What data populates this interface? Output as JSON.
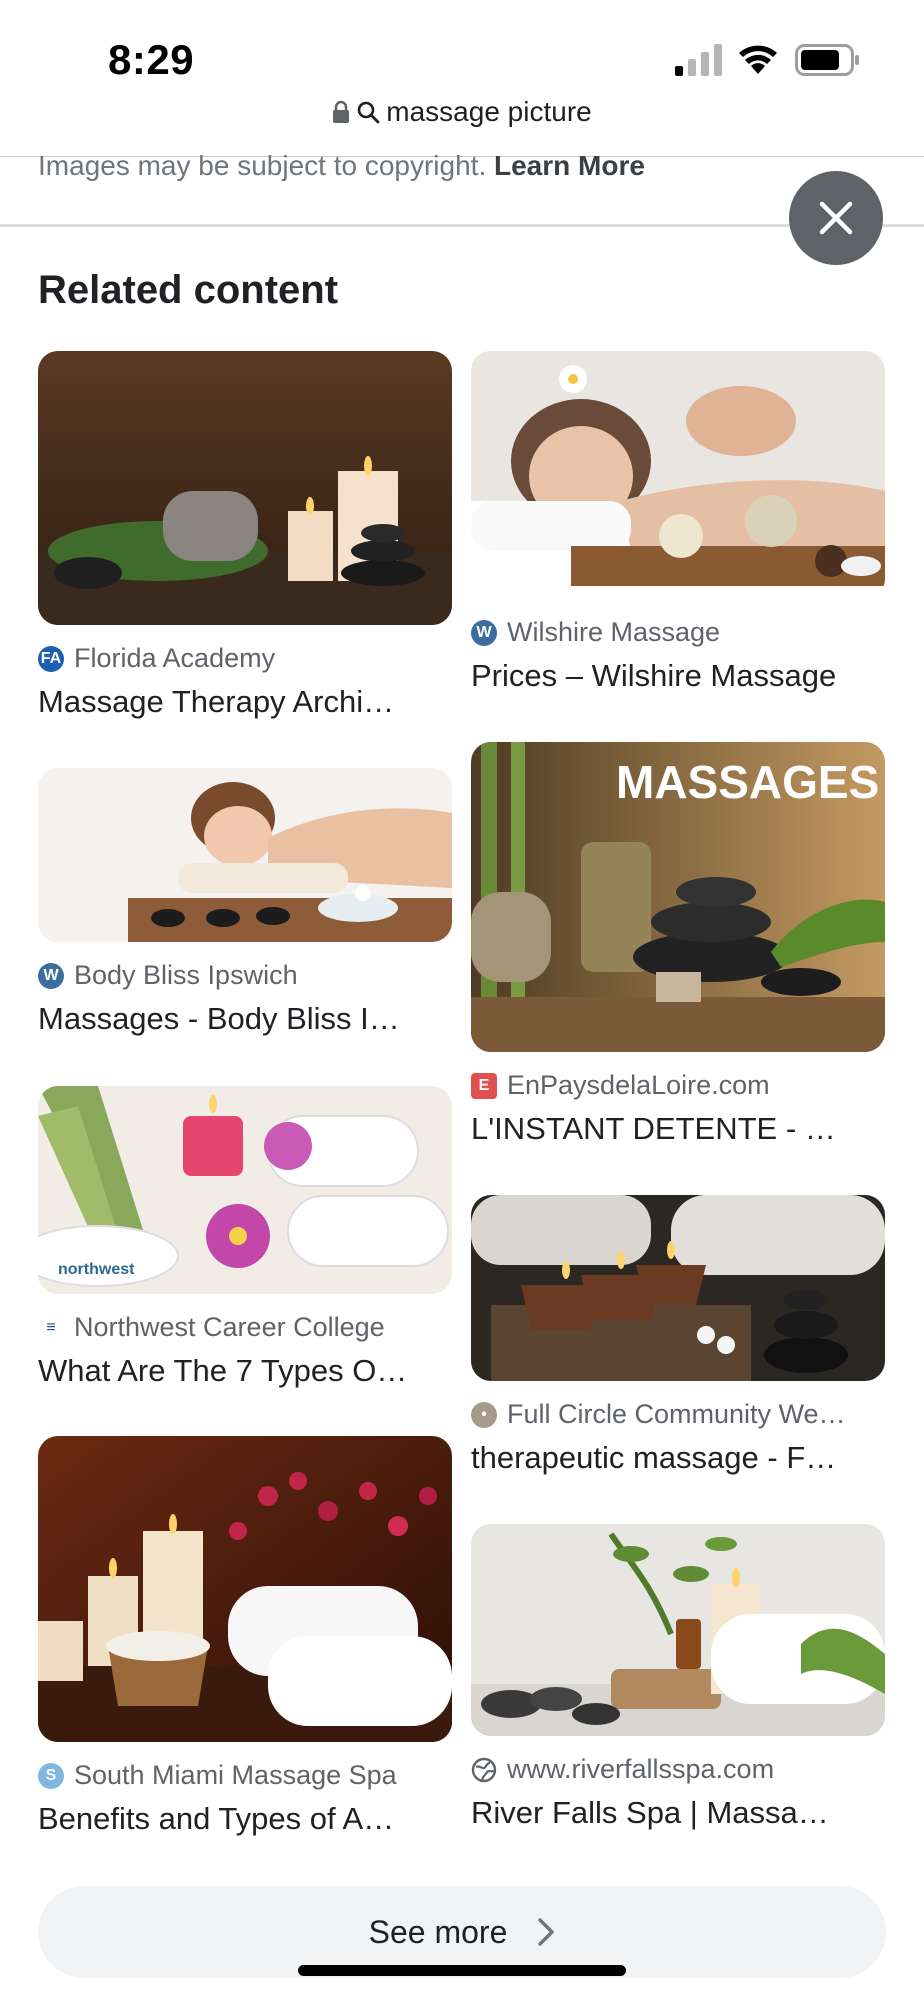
{
  "status": {
    "time": "8:29"
  },
  "browser": {
    "url_text": "massage picture"
  },
  "banner": {
    "text": "Images may be subject to copyright. ",
    "link": "Learn More"
  },
  "section": {
    "title": "Related content"
  },
  "results": [
    {
      "source": "Florida Academy",
      "title": "Massage Therapy Archi…"
    },
    {
      "source": "Wilshire Massage",
      "title": "Prices – Wilshire Massage"
    },
    {
      "source": "Body Bliss Ipswich",
      "title": "Massages - Body Bliss I…"
    },
    {
      "source": "EnPaysdelaLoire.com",
      "title": "L'INSTANT DETENTE - …",
      "image_text": "MASSAGES"
    },
    {
      "source": "Northwest Career College",
      "title": "What Are The 7 Types O…",
      "image_text": "northwest"
    },
    {
      "source": "Full Circle Community We…",
      "title": "therapeutic massage - F…"
    },
    {
      "source": "South Miami Massage Spa",
      "title": "Benefits and Types of A…"
    },
    {
      "source": "www.riverfallsspa.com",
      "title": "River Falls Spa | Massa…"
    }
  ],
  "see_more": {
    "label": "See more"
  },
  "icons": {
    "close": "close-icon",
    "lock": "lock-icon",
    "search": "search-icon",
    "chevron": "chevron-right-icon",
    "globe": "globe-icon",
    "wordpress": "wordpress-icon"
  },
  "colors": {
    "close_button": "#5f6368",
    "see_more_bg": "#f1f3f4",
    "divider": "#dadce0"
  }
}
